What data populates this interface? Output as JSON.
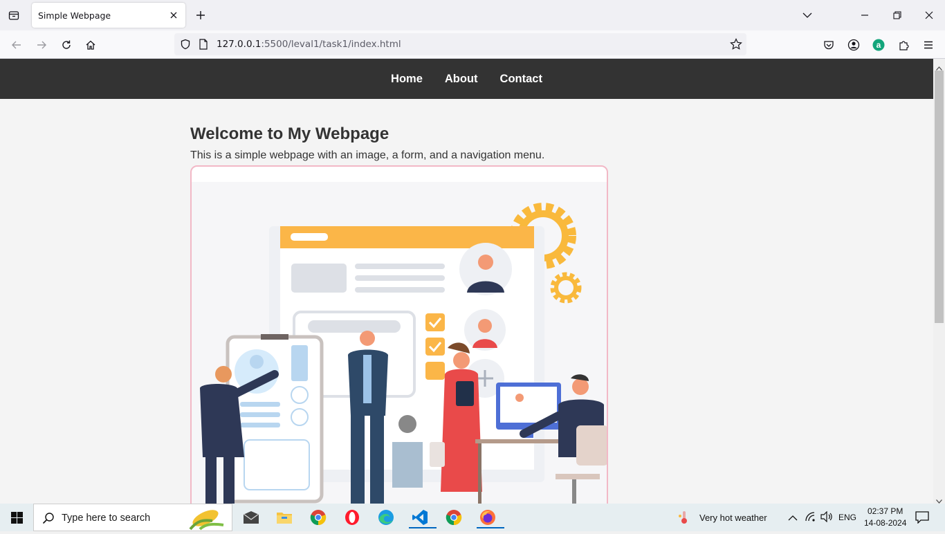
{
  "browser": {
    "tab_title": "Simple Webpage",
    "url_host": "127.0.0.1",
    "url_rest": ":5500/leval1/task1/index.html"
  },
  "site": {
    "nav": [
      "Home",
      "About",
      "Contact"
    ],
    "heading": "Welcome to My Webpage",
    "intro": "This is a simple webpage with an image, a form, and a navigation menu."
  },
  "taskbar": {
    "search_placeholder": "Type here to search",
    "weather": "Very hot weather",
    "lang": "ENG",
    "time": "02:37 PM",
    "date": "14-08-2024"
  },
  "colors": {
    "site_nav_bg": "#333333",
    "hero_border": "#f2b8c6",
    "accent_orange": "#f9a73e"
  }
}
